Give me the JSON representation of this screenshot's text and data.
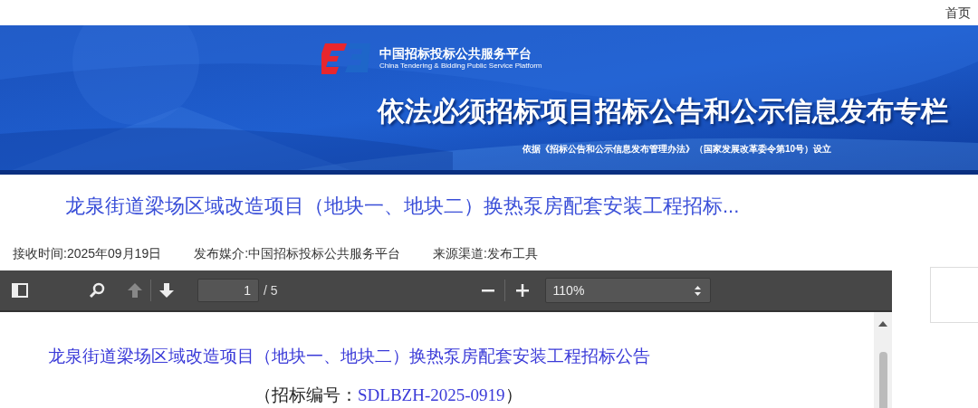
{
  "top_bar": {
    "home_link": "首页"
  },
  "banner": {
    "platform_name": "中国招标投标公共服务平台",
    "platform_name_en": "China Tendering & Bidding Public Service Platform",
    "heading": "依法必须招标项目招标公告和公示信息发布专栏",
    "basis": "依据《招标公告和公示信息发布管理办法》（国家发展改革委令第10号）设立"
  },
  "notice": {
    "title": "龙泉街道梁场区域改造项目（地块一、地块二）换热泵房配套安装工程招标...",
    "meta": [
      {
        "label": "接收时间:2025年09月19日"
      },
      {
        "label": "发布媒介:中国招标投标公共服务平台"
      },
      {
        "label": "来源渠道:发布工具"
      }
    ]
  },
  "pdf_viewer": {
    "page": "1",
    "page_count": "/ 5",
    "zoom": "110%",
    "document": {
      "title": "龙泉街道梁场区域改造项目（地块一、地块二）换热泵房配套安装工程招标公告",
      "number_label": "（招标编号：",
      "number": "SDLBZH-2025-0919",
      "number_end": "）"
    }
  }
}
